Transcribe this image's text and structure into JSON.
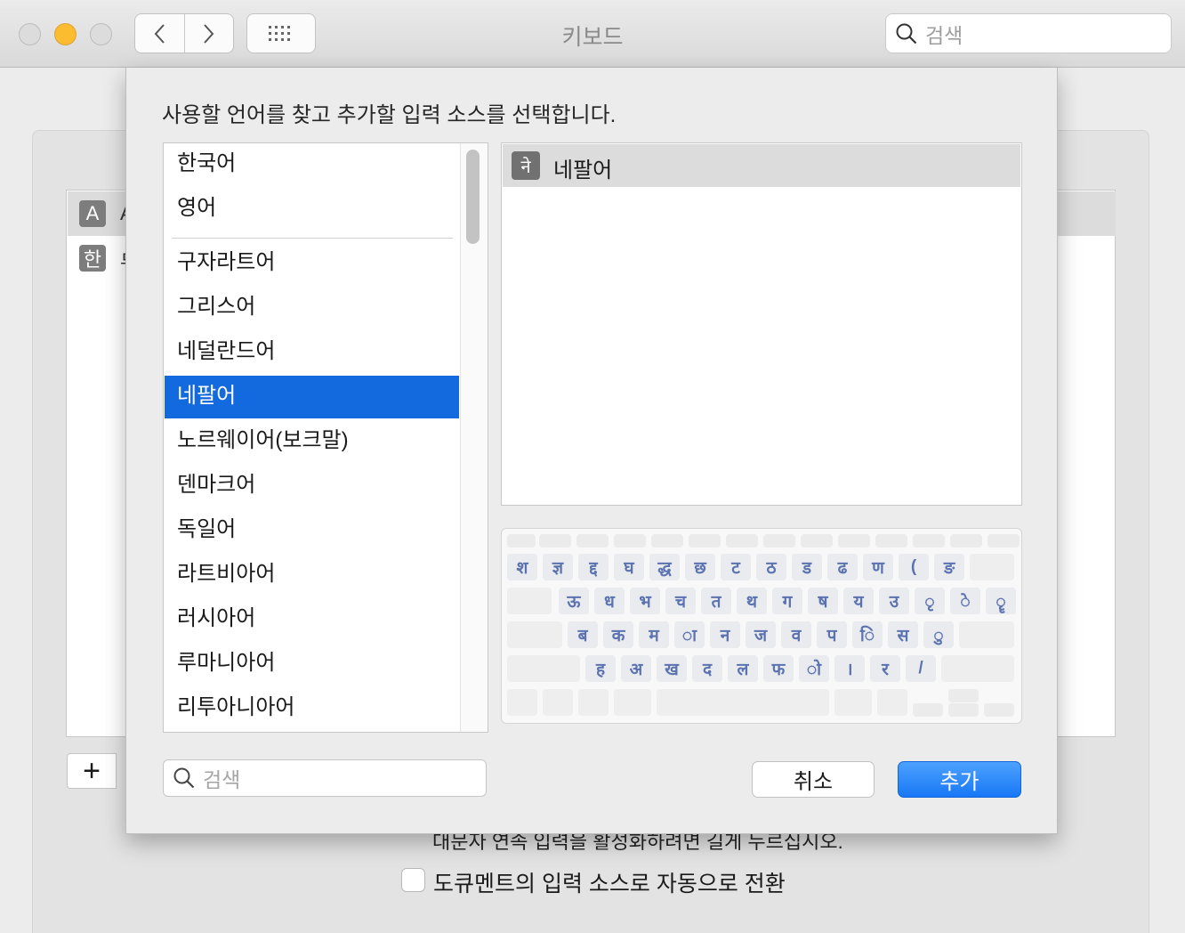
{
  "window": {
    "title": "키보드",
    "search_placeholder": "검색"
  },
  "background": {
    "input_sources": [
      {
        "badge": "A",
        "label_partial": "A"
      },
      {
        "badge": "한",
        "label_partial": "두"
      }
    ],
    "add_button": "+",
    "caps_hint": "대문자 연속 입력을 활성화하려면 길게 누르십시오.",
    "auto_switch_checkbox": {
      "label": "도큐멘트의 입력 소스로 자동으로 전환",
      "checked": false
    }
  },
  "sheet": {
    "prompt": "사용할 언어를 찾고 추가할 입력 소스를 선택합니다.",
    "languages": [
      "한국어",
      "영어",
      "구자라트어",
      "그리스어",
      "네덜란드어",
      "네팔어",
      "노르웨이어(보크말)",
      "덴마크어",
      "독일어",
      "라트비아어",
      "러시아어",
      "루마니아어",
      "리투아니아어"
    ],
    "selected_language": "네팔어",
    "sources": [
      {
        "icon_glyph": "ने",
        "label": "네팔어"
      }
    ],
    "keyboard_rows": [
      [
        "श",
        "ज्ञ",
        "द्द",
        "घ",
        "द्ध",
        "छ",
        "ट",
        "ठ",
        "ड",
        "ढ",
        "ण",
        "(",
        "ङ"
      ],
      [
        "ऊ",
        "ध",
        "भ",
        "च",
        "त",
        "थ",
        "ग",
        "ष",
        "य",
        "उ",
        "ृ",
        "े",
        "ॄ"
      ],
      [
        "ब",
        "क",
        "म",
        "ा",
        "न",
        "ज",
        "व",
        "प",
        "ि",
        "स",
        "ु"
      ],
      [
        "ह",
        "अ",
        "ख",
        "द",
        "ल",
        "फ",
        "ो",
        "।",
        "र",
        "/"
      ]
    ],
    "search_placeholder": "검색",
    "cancel_label": "취소",
    "add_label": "추가",
    "accent_color": "#1369de"
  }
}
